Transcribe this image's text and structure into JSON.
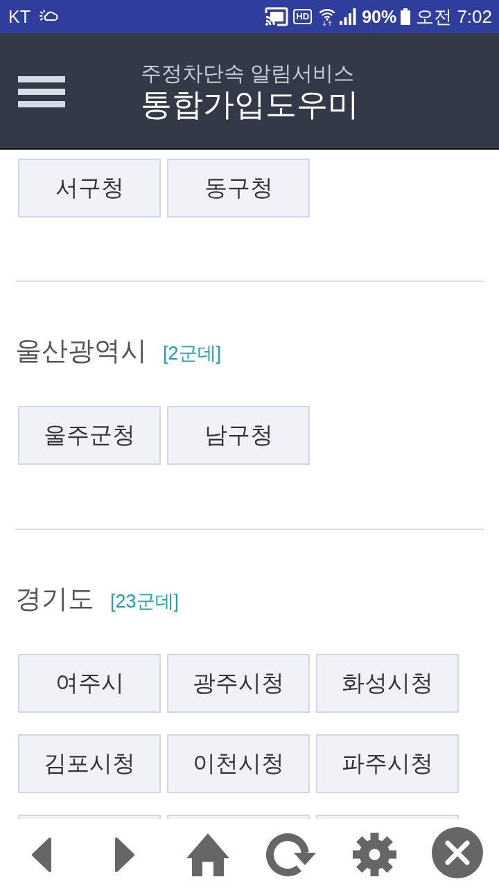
{
  "status_bar": {
    "carrier": "KT",
    "hd": "HD",
    "battery": "90%",
    "time": "오전 7:02"
  },
  "header": {
    "subtitle": "주정차단속 알림서비스",
    "title": "통합가입도우미"
  },
  "sections": [
    {
      "items": [
        {
          "kind": "tile",
          "label": "서구청"
        },
        {
          "kind": "tile",
          "label": "동구청"
        }
      ]
    },
    {
      "name": "울산광역시",
      "count": "[2군데]",
      "items": [
        {
          "kind": "tile",
          "label": "울주군청"
        },
        {
          "kind": "tile",
          "label": "남구청"
        }
      ]
    },
    {
      "name": "경기도",
      "count": "[23군데]",
      "items": [
        {
          "kind": "tile",
          "label": "여주시"
        },
        {
          "kind": "tile",
          "label": "광주시청"
        },
        {
          "kind": "tile",
          "label": "화성시청"
        },
        {
          "kind": "tile",
          "label": "김포시청"
        },
        {
          "kind": "tile",
          "label": "이천시청"
        },
        {
          "kind": "tile",
          "label": "파주시청"
        },
        {
          "kind": "cut"
        },
        {
          "kind": "cut"
        },
        {
          "kind": "cut"
        }
      ]
    }
  ]
}
